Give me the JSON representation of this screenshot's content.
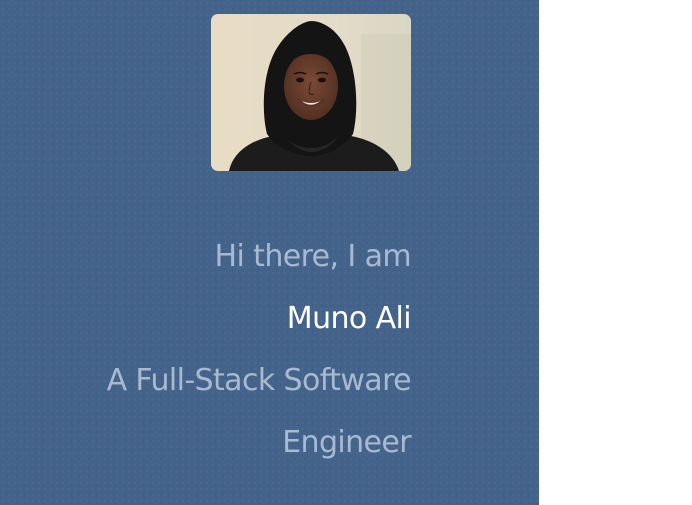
{
  "profile": {
    "greeting": "Hi there, I am",
    "name": "Muno Ali",
    "role_line1": "A Full-Stack Software",
    "role_line2": "Engineer"
  },
  "colors": {
    "sidebar_background": "#44638b",
    "muted_text": "#a9bad0",
    "name_text": "#ffffff",
    "page_background": "#ffffff"
  }
}
